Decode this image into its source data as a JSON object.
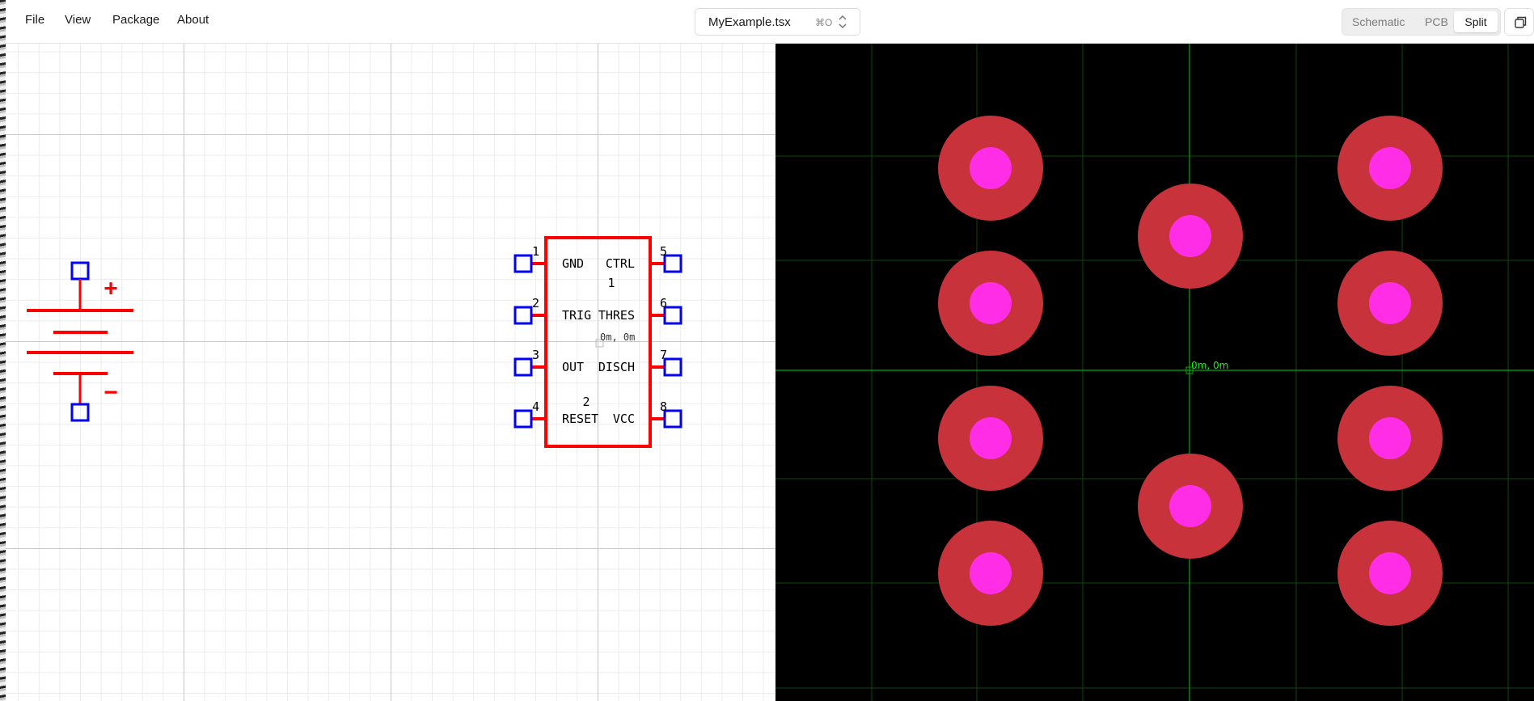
{
  "menu": {
    "file": "File",
    "view": "View",
    "package": "Package",
    "about": "About"
  },
  "file_select": {
    "filename": "MyExample.tsx",
    "shortcut": "⌘O"
  },
  "view_toggle": {
    "schematic": "Schematic",
    "pcb": "PCB",
    "split": "Split",
    "selected": "Split"
  },
  "schematic": {
    "battery": {
      "plus": "+",
      "minus": "−"
    },
    "chip": {
      "pins": [
        {
          "number": "1",
          "label": "GND"
        },
        {
          "number": "2",
          "label": "TRIG"
        },
        {
          "number": "3",
          "label": "OUT"
        },
        {
          "number": "4",
          "label": "RESET"
        },
        {
          "number": "5",
          "label": "CTRL"
        },
        {
          "number": "6",
          "label": "THRES"
        },
        {
          "number": "7",
          "label": "DISCH"
        },
        {
          "number": "8",
          "label": "VCC"
        }
      ],
      "side_label_1": "1",
      "side_label_2": "2"
    },
    "origin_label": "0m, 0m",
    "colors": {
      "symbol": "#ff0000",
      "port": "#0000ff",
      "text": "#000000"
    }
  },
  "pcb": {
    "origin_label": "0m, 0m",
    "colors": {
      "background": "#000000",
      "grid": "#0b4a0b",
      "axis": "#00b000",
      "pad_ring": "#c8323a",
      "pad_hole": "#ff2ee6",
      "origin_text": "#00ff00"
    }
  }
}
